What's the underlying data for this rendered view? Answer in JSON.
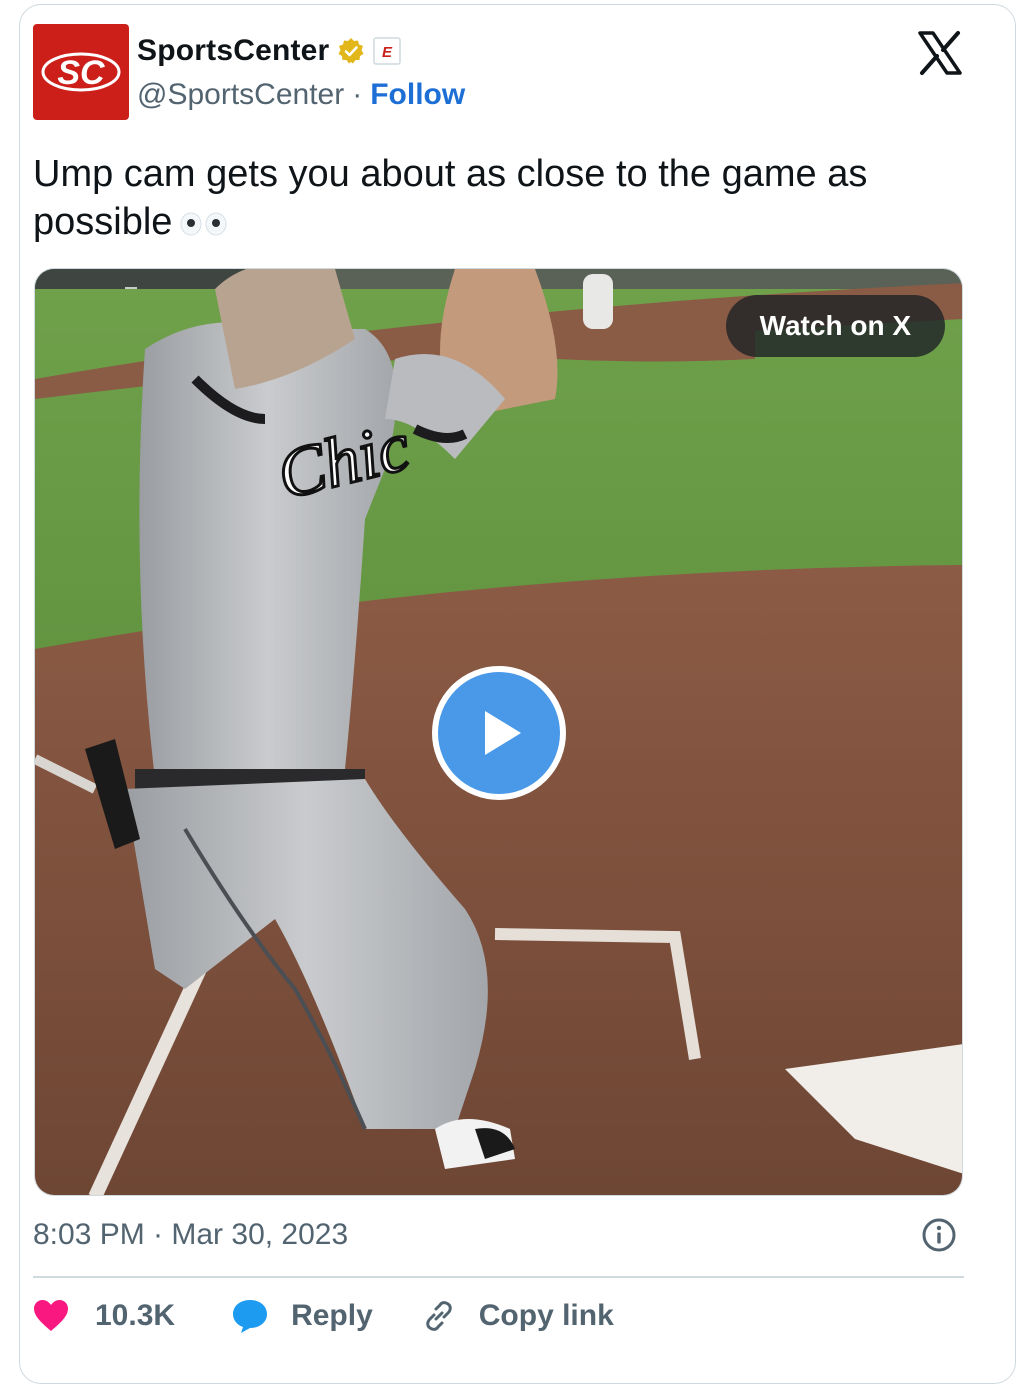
{
  "author": {
    "name": "SportsCenter",
    "handle": "@SportsCenter",
    "separator": "·",
    "follow_label": "Follow",
    "avatar_text": "SC",
    "affiliate_badge": "E"
  },
  "tweet": {
    "text": "Ump cam gets you about as close to the game as possible"
  },
  "media": {
    "watch_label": "Watch on X",
    "jersey_text": "Chic"
  },
  "meta": {
    "timestamp": "8:03 PM · Mar 30, 2023"
  },
  "actions": {
    "likes": "10.3K",
    "reply_label": "Reply",
    "copy_label": "Copy link"
  },
  "colors": {
    "avatar_bg": "#cc1f1a",
    "follow": "#1d6fd6",
    "like": "#f91880",
    "reply": "#1d9bf0",
    "play": "#4a99e9",
    "verified": "#e2b719"
  },
  "icons": [
    "x-logo-icon",
    "verified-badge-icon",
    "espn-affiliate-icon",
    "eyes-emoji",
    "play-icon",
    "info-icon",
    "heart-icon",
    "reply-bubble-icon",
    "link-icon"
  ]
}
